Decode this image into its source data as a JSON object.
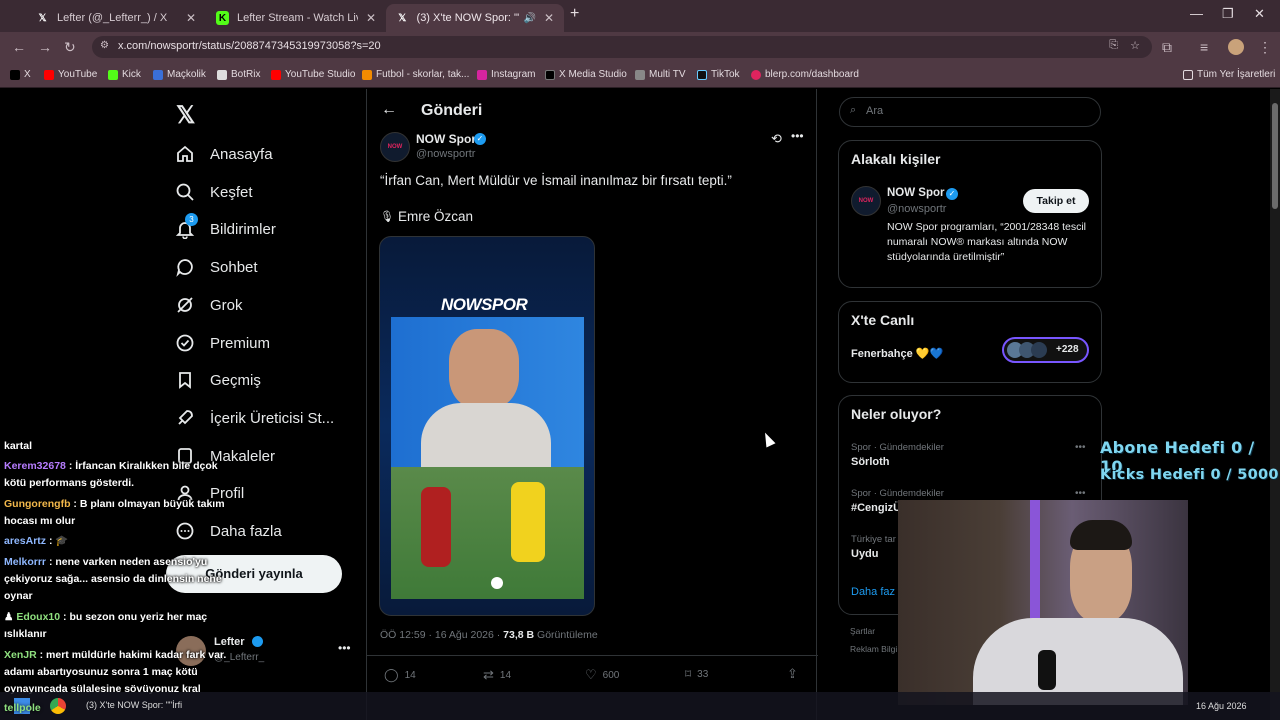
{
  "browser": {
    "tabs": [
      {
        "title": "Lefter (@_Lefterr_) / X",
        "icon": "x-logo-icon"
      },
      {
        "title": "Lefter Stream - Watch Live on Kick",
        "icon": "kick-logo-icon"
      },
      {
        "title": "(3) X'te NOW Spor: \"\"İrfan C...",
        "icon": "x-logo-icon"
      }
    ],
    "url": "x.com/nowsportr/status/2088747345319973058?s=20",
    "bookmarks": [
      "X",
      "YouTube",
      "Kick",
      "Maçkolik",
      "BotRix",
      "YouTube Studio",
      "Futbol - skorlar, tak...",
      "Instagram",
      "X Media Studio",
      "Multi TV",
      "TikTok",
      "blerp.com/dashboard"
    ],
    "all_bookmarks": "Tüm Yer İşaretleri"
  },
  "nav": {
    "items": [
      {
        "label": "Anasayfa",
        "icon": "home-icon"
      },
      {
        "label": "Keşfet",
        "icon": "search-icon"
      },
      {
        "label": "Bildirimler",
        "icon": "bell-icon",
        "badge": "3"
      },
      {
        "label": "Sohbet",
        "icon": "chat-icon"
      },
      {
        "label": "Grok",
        "icon": "grok-icon"
      },
      {
        "label": "Premium",
        "icon": "verified-icon"
      },
      {
        "label": "Geçmiş",
        "icon": "bookmark-icon"
      },
      {
        "label": "İçerik Üreticisi St...",
        "icon": "rocket-icon"
      },
      {
        "label": "Makaleler",
        "icon": "article-icon"
      },
      {
        "label": "Profil",
        "icon": "profile-icon"
      },
      {
        "label": "Daha fazla",
        "icon": "more-circle-icon"
      }
    ],
    "post_button": "Gönderi yayınla",
    "account_name": "Lefter",
    "account_handle": "@_Lefterr_"
  },
  "post": {
    "header_title": "Gönderi",
    "author_name": "NOW Spor",
    "author_handle": "@nowsportr",
    "text": "“İrfan Can, Mert Müldür ve İsmail inanılmaz bir fırsatı tepti.”",
    "subtext": "Emre Özcan",
    "image_brand": "NOWSPOR",
    "timestamp": "ÖÖ 12:59 · 16 Ağu 2026 ·",
    "views_count": "73,8 B",
    "views_label": "Görüntüleme",
    "replies": "14",
    "reposts": "14",
    "likes": "600",
    "bookmarks": "33"
  },
  "sidebar": {
    "search_placeholder": "Ara",
    "related": {
      "title": "Alakalı kişiler",
      "name": "NOW Spor",
      "handle": "@nowsportr",
      "bio": "NOW Spor programları, “2001/28348 tescil numaralı NOW® markası altında NOW stüdyolarında üretilmiştir”",
      "follow": "Takip et"
    },
    "live": {
      "title": "X'te Canlı",
      "name": "Fenerbahçe 💛💙",
      "count": "+228"
    },
    "trends": {
      "title": "Neler oluyor?",
      "items": [
        {
          "meta": "Spor · Gündemdekiler",
          "name": "Sörloth"
        },
        {
          "meta": "Spor · Gündemdekiler",
          "name": "#CengizÜ"
        },
        {
          "meta": "Türkiye tar",
          "name": "Uydu"
        }
      ],
      "more": "Daha faz"
    },
    "footer": [
      "Şartlar",
      "Reklam Bilgi"
    ]
  },
  "chat": [
    {
      "user": "",
      "text": "kartal"
    },
    {
      "user": "Kerem32678",
      "color": "#b77dff",
      "text": ": İrfancan Kiralıkken bile dçok kötü performans gösterdi."
    },
    {
      "user": "Gungorengfb",
      "color": "#f2b84b",
      "text": ": B planı olmayan büyük takım hocası mı olur"
    },
    {
      "user": "aresArtz",
      "color": "#8fb8ff",
      "text": ":"
    },
    {
      "user": "Melkorrr",
      "color": "#8fb8ff",
      "text": ": nene varken neden asensio'yu çekiyoruz sağa... asensio da dinlensin nene oynar"
    },
    {
      "user": "Edoux10",
      "color": "#8fe07f",
      "text": ": bu sezon onu yeriz her maç ıslıklanır"
    },
    {
      "user": "XenJR",
      "color": "#8fe07f",
      "text": ": mert müldürle hakimi kadar fark var. adamı abartıyosunuz sonra 1 maç kötü oynayıncada sülalesine sövüyonuz kral"
    }
  ],
  "overlay": {
    "goal1": "Abone Hedefi 0 / 10",
    "goal2": "Kicks Hedefi 0 / 5000"
  },
  "taskbar": {
    "task": "(3) X'te NOW Spor: \"\"İrfi",
    "date": "16 Ağu 2026",
    "chat_tail": "tellpole"
  },
  "colors": {
    "accent": "#1d9bf0",
    "bg": "#000000",
    "border": "#2f3336",
    "chrome": "#4f3943"
  }
}
